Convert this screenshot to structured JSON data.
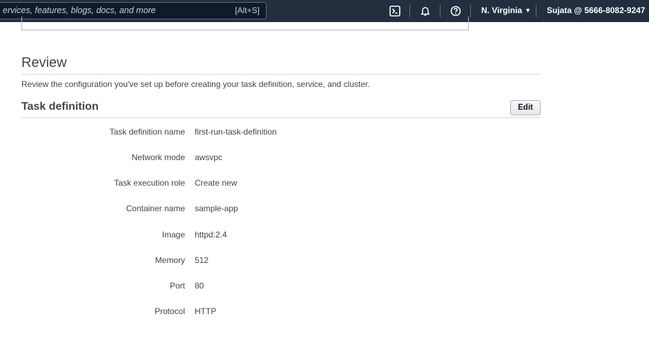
{
  "topbar": {
    "search_placeholder": "ervices, features, blogs, docs, and more",
    "search_shortcut": "[Alt+S]",
    "cloudshell_icon": "terminal-icon",
    "notifications_icon": "bell-icon",
    "help_icon": "help-circle-icon",
    "region": "N. Virginia",
    "account": "Sujata @ 5666-8082-9247",
    "colors": {
      "bar": "#232f3e",
      "search_bg": "#0f1b2a"
    }
  },
  "review": {
    "title": "Review",
    "description": "Review the configuration you've set up before creating your task definition, service, and cluster."
  },
  "task_definition": {
    "section_title": "Task definition",
    "edit_label": "Edit",
    "fields": [
      {
        "label": "Task definition name",
        "value": "first-run-task-definition"
      },
      {
        "label": "Network mode",
        "value": "awsvpc"
      },
      {
        "label": "Task execution role",
        "value": "Create new"
      },
      {
        "label": "Container name",
        "value": "sample-app"
      },
      {
        "label": "Image",
        "value": "httpd:2.4"
      },
      {
        "label": "Memory",
        "value": "512"
      },
      {
        "label": "Port",
        "value": "80"
      },
      {
        "label": "Protocol",
        "value": "HTTP"
      }
    ]
  }
}
